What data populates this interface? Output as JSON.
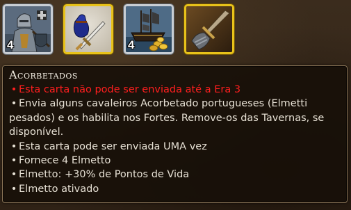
{
  "cards": [
    {
      "name": "knight-card",
      "count": "4",
      "border": "silver"
    },
    {
      "name": "money-bag-card",
      "count": "",
      "border": "gold"
    },
    {
      "name": "ship-card",
      "count": "4",
      "border": "silver"
    },
    {
      "name": "gauntlet-card",
      "count": "",
      "border": "gold"
    }
  ],
  "tooltip": {
    "title": "Acorbetados",
    "bullet_char": "•",
    "lines": [
      "Esta carta não pode ser enviada até a Era 3",
      "Envia alguns cavaleiros Acorbetado portugueses (Elmetti pesados) e os habilita nos Fortes. Remove-os das Tavernas, se disponível.",
      "Esta carta pode ser enviada UMA vez",
      "Fornece 4 Elmetto",
      "Elmetto: +30% de Pontos de Vida",
      "Elmetto ativado"
    ]
  },
  "colors": {
    "warning": "#ff1e1e",
    "text": "#e6e0d4",
    "gold_border": "#e8c21a",
    "silver_border": "#c9ced4"
  }
}
